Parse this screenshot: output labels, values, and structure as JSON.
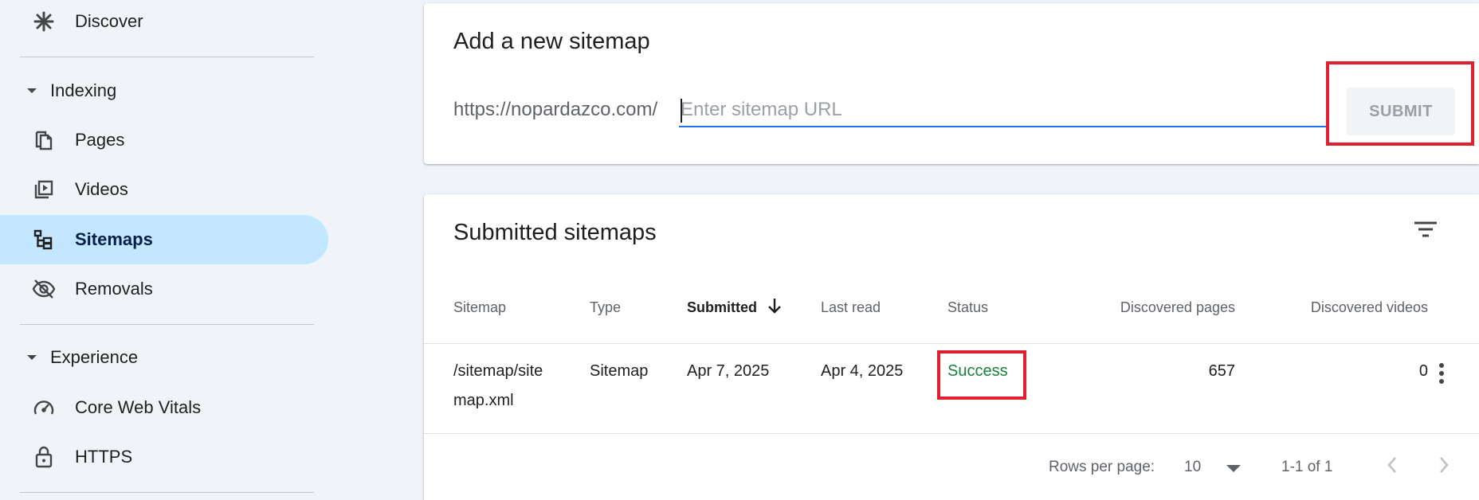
{
  "sidebar": {
    "discover": "Discover",
    "indexing": "Indexing",
    "pages": "Pages",
    "videos": "Videos",
    "sitemaps": "Sitemaps",
    "removals": "Removals",
    "experience": "Experience",
    "core_web_vitals": "Core Web Vitals",
    "https": "HTTPS",
    "active_item": "Sitemaps"
  },
  "add_sitemap": {
    "title": "Add a new sitemap",
    "prefix": "https://nopardazco.com/",
    "placeholder": "Enter sitemap URL",
    "value": "",
    "submit_label": "SUBMIT"
  },
  "submitted": {
    "title": "Submitted sitemaps",
    "columns": {
      "sitemap": "Sitemap",
      "type": "Type",
      "submitted": "Submitted",
      "last_read": "Last read",
      "status": "Status",
      "discovered_pages": "Discovered pages",
      "discovered_videos": "Discovered videos"
    },
    "rows": [
      {
        "sitemap_line1": "/sitemap/site",
        "sitemap_line2": "map.xml",
        "type": "Sitemap",
        "submitted": "Apr 7, 2025",
        "last_read": "Apr 4, 2025",
        "status": "Success",
        "discovered_pages": "657",
        "discovered_videos": "0"
      }
    ],
    "footer": {
      "rows_per_page_label": "Rows per page:",
      "rows_per_page_value": "10",
      "range": "1-1 of 1"
    }
  },
  "colors": {
    "accent": "#1a73e8",
    "active_nav": "#c2e7ff",
    "success": "#188038",
    "highlight": "#e0202e"
  }
}
